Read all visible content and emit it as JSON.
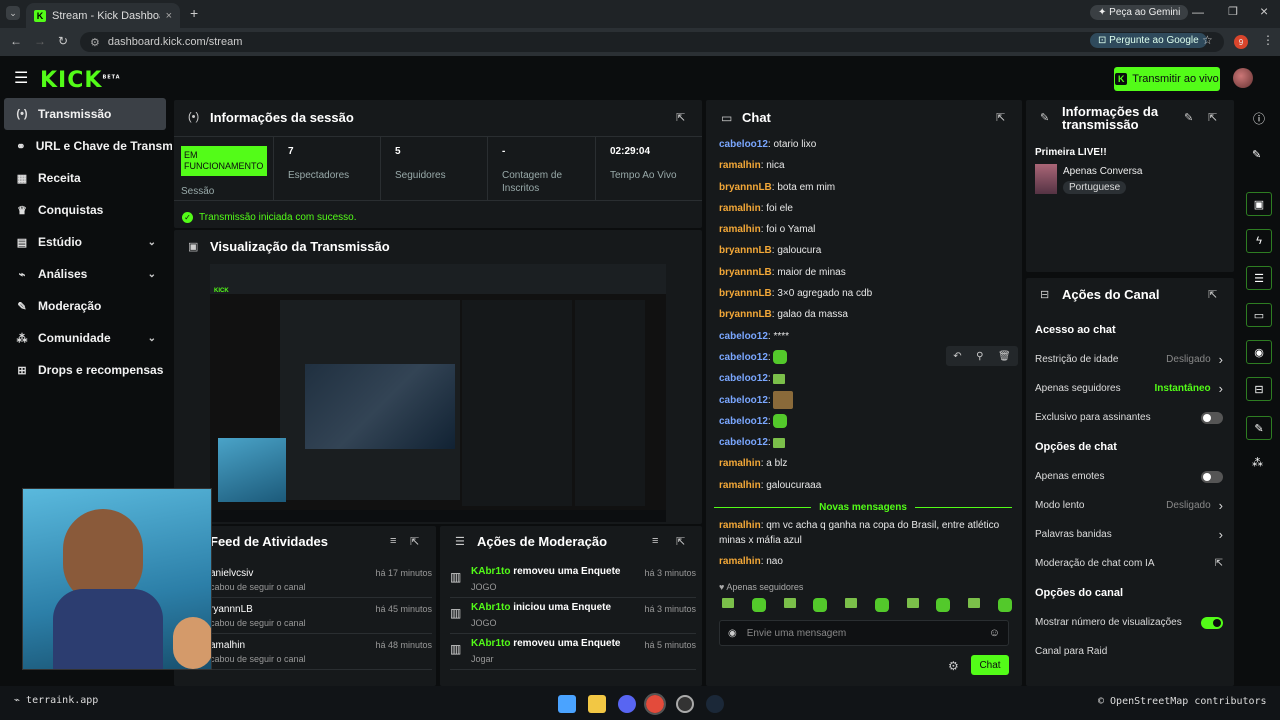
{
  "browser": {
    "tab_title": "Stream - Kick Dashboard",
    "url": "dashboard.kick.com/stream",
    "gemini": "Peça ao Gemini",
    "google": "Pergunte ao Google",
    "profile_letter": "9"
  },
  "header": {
    "logo": "KICK",
    "beta": "BETA",
    "go_live": "Transmitir ao vivo"
  },
  "sidebar": {
    "items": [
      {
        "label": "Transmissão",
        "icon": "broadcast-icon"
      },
      {
        "label": "URL e Chave de Transmissão",
        "icon": "link-icon"
      },
      {
        "label": "Receita",
        "icon": "revenue-icon"
      },
      {
        "label": "Conquistas",
        "icon": "trophy-icon"
      },
      {
        "label": "Estúdio",
        "icon": "studio-icon",
        "chevron": "⌄"
      },
      {
        "label": "Análises",
        "icon": "chart-icon",
        "chevron": "⌄"
      },
      {
        "label": "Moderação",
        "icon": "wrench-icon"
      },
      {
        "label": "Comunidade",
        "icon": "community-icon",
        "chevron": "⌄"
      },
      {
        "label": "Drops e recompensas",
        "icon": "gift-icon"
      }
    ]
  },
  "session": {
    "title": "Informações da sessão",
    "status": "EM FUNCIONAMENTO",
    "status_label": "Sessão",
    "stats": [
      {
        "value": "7",
        "label": "Espectadores"
      },
      {
        "value": "5",
        "label": "Seguidores"
      },
      {
        "value": "-",
        "label": "Contagem de Inscritos"
      },
      {
        "value": "02:29:04",
        "label": "Tempo Ao Vivo"
      }
    ],
    "success": "Transmissão iniciada com sucesso."
  },
  "preview": {
    "title": "Visualização da Transmissão"
  },
  "chat": {
    "title": "Chat",
    "messages": [
      {
        "user": "cabeloo12",
        "color": "blue",
        "text": ": otario lixo"
      },
      {
        "user": "ramalhin",
        "color": "orange",
        "text": ": nica"
      },
      {
        "user": "bryannnLB",
        "color": "orange",
        "text": ": bota em mim"
      },
      {
        "user": "ramalhin",
        "color": "orange",
        "text": ": foi ele"
      },
      {
        "user": "ramalhin",
        "color": "orange",
        "text": ": foi o Yamal"
      },
      {
        "user": "bryannnLB",
        "color": "orange",
        "text": ": galoucura"
      },
      {
        "user": "bryannnLB",
        "color": "orange",
        "text": ": maior de minas"
      },
      {
        "user": "bryannnLB",
        "color": "orange",
        "text": ": 3×0 agregado na cdb"
      },
      {
        "user": "bryannnLB",
        "color": "orange",
        "text": ": galao da massa"
      },
      {
        "user": "cabeloo12",
        "color": "blue",
        "text": ": ****"
      },
      {
        "user": "cabeloo12",
        "color": "blue",
        "text": ":",
        "emote": "emo"
      },
      {
        "user": "cabeloo12",
        "color": "blue",
        "text": ":",
        "emote": "emo s"
      },
      {
        "user": "cabeloo12",
        "color": "blue",
        "text": ":",
        "emote": "emo p"
      },
      {
        "user": "cabeloo12",
        "color": "blue",
        "text": ":",
        "emote": "emo"
      },
      {
        "user": "cabeloo12",
        "color": "blue",
        "text": ":",
        "emote": "emo s"
      },
      {
        "user": "ramalhin",
        "color": "orange",
        "text": ": a blz"
      },
      {
        "user": "ramalhin",
        "color": "orange",
        "text": ": galoucuraaa"
      }
    ],
    "new_messages": "Novas mensagens",
    "new": [
      {
        "user": "ramalhin",
        "text": ": qm vc acha q ganha na copa do Brasil, entre atlético"
      },
      {
        "user": "",
        "text": "minas x máfia azul"
      },
      {
        "user": "ramalhin",
        "text": ": nao"
      }
    ],
    "followers_only": "Apenas seguidores",
    "input_placeholder": "Envie uma mensagem",
    "send": "Chat"
  },
  "stream_info": {
    "title_line1": "Informações da",
    "title_line2": "transmissão",
    "stream_title": "Primeira LIVE!!",
    "category": "Apenas Conversa",
    "language": "Portuguese"
  },
  "channel_actions": {
    "title": "Ações do Canal",
    "chat_access": "Acesso ao chat",
    "rows1": [
      {
        "label": "Restrição de idade",
        "value": "Desligado",
        "type": "chev"
      },
      {
        "label": "Apenas seguidores",
        "value": "Instantâneo",
        "type": "chev-green"
      },
      {
        "label": "Exclusivo para assinantes",
        "type": "toggle-off"
      }
    ],
    "chat_options": "Opções de chat",
    "rows2": [
      {
        "label": "Apenas emotes",
        "type": "toggle-off"
      },
      {
        "label": "Modo lento",
        "value": "Desligado",
        "type": "chev"
      },
      {
        "label": "Palavras banidas",
        "type": "chev"
      },
      {
        "label": "Moderação de chat com IA",
        "type": "ext"
      }
    ],
    "channel_options": "Opções do canal",
    "rows3": [
      {
        "label": "Mostrar número de visualizações",
        "type": "toggle-on"
      },
      {
        "label": "Canal para Raid",
        "type": "none"
      }
    ]
  },
  "feed": {
    "title": "Feed de Atividades",
    "items": [
      {
        "user": "anielvcsiv",
        "time": "há 17 minutos",
        "action": "cabou de seguir o canal"
      },
      {
        "user": "ryannnLB",
        "time": "há 45 minutos",
        "action": "cabou de seguir o canal"
      },
      {
        "user": "amalhin",
        "time": "há 48 minutos",
        "action": "cabou de seguir o canal"
      }
    ]
  },
  "moderation": {
    "title": "Ações de Moderação",
    "items": [
      {
        "user": "KAbr1to",
        "action": " removeu uma Enquete",
        "sub": "JOGO",
        "time": "há 3 minutos"
      },
      {
        "user": "KAbr1to",
        "action": " iniciou uma Enquete",
        "sub": "JOGO",
        "time": "há 3 minutos"
      },
      {
        "user": "KAbr1to",
        "action": " removeu uma Enquete",
        "sub": "Jogar",
        "time": "há 5 minutos"
      }
    ]
  },
  "taskbar": {
    "left_text": "terraink.app",
    "right_text": "© OpenStreetMap contributors"
  },
  "colors": {
    "accent": "#53fc18",
    "bg": "#0b0d0e",
    "panel": "#16191b"
  }
}
